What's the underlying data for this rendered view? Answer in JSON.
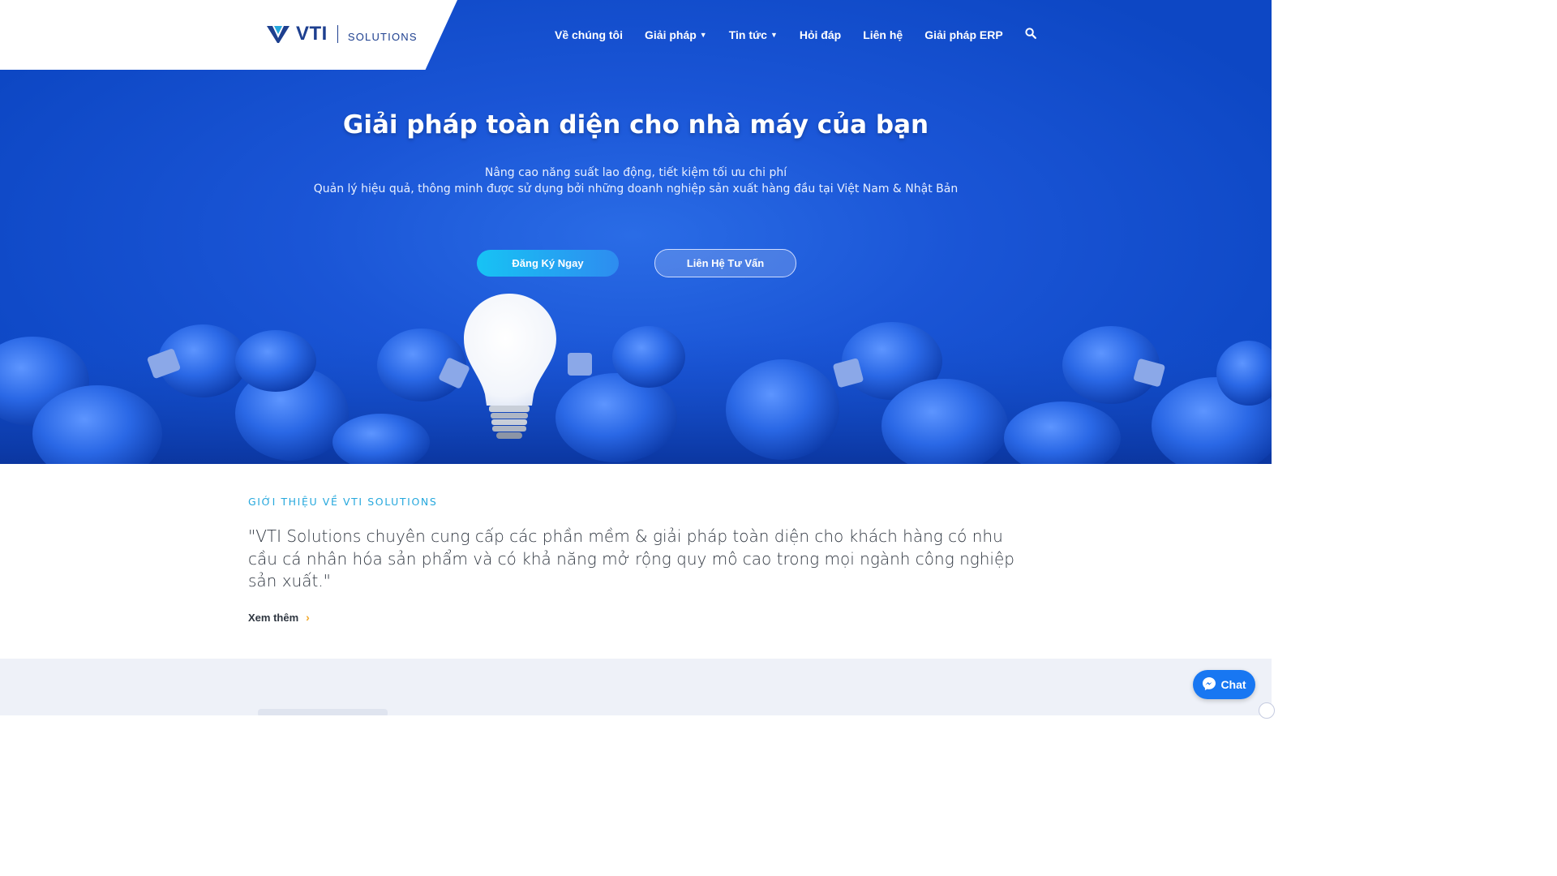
{
  "brand": {
    "logo_primary": "VTI",
    "logo_secondary": "SOLUTIONS",
    "color_dark": "#1d3f8f",
    "color_accent": "#26a8dd"
  },
  "nav": {
    "items": [
      {
        "label": "Về chúng tôi",
        "dropdown": false
      },
      {
        "label": "Giải pháp",
        "dropdown": true
      },
      {
        "label": "Tin tức",
        "dropdown": true
      },
      {
        "label": "Hỏi đáp",
        "dropdown": false
      },
      {
        "label": "Liên hệ",
        "dropdown": false
      },
      {
        "label": "Giải pháp ERP",
        "dropdown": false
      }
    ],
    "search_icon": "search-icon"
  },
  "hero": {
    "title": "Giải pháp toàn diện cho nhà máy của bạn",
    "subtitle_line1": "Nâng cao năng suất lao động, tiết kiệm tối ưu chi phí",
    "subtitle_line2": "Quản lý hiệu quả, thông minh được sử dụng bởi những doanh nghiệp sản xuất hàng đầu tại Việt Nam & Nhật Bản",
    "primary_button": "Đăng Ký Ngay",
    "secondary_button": "Liên Hệ Tư Vấn",
    "bg_color": "#1a55d6"
  },
  "intro": {
    "eyebrow": "GIỚI THIỆU VỀ VTI SOLUTIONS",
    "quote": "\"VTI Solutions chuyên cung cấp các phần mềm & giải pháp toàn diện cho khách hàng có nhu cầu cá nhân hóa sản phẩm và có khả năng mở rộng quy mô cao trong mọi ngành công nghiệp sản xuất.\"",
    "more_label": "Xem thêm",
    "arrow_color": "#f2a92a"
  },
  "chat": {
    "label": "Chat",
    "icon": "messenger-icon",
    "color": "#1877f2"
  }
}
